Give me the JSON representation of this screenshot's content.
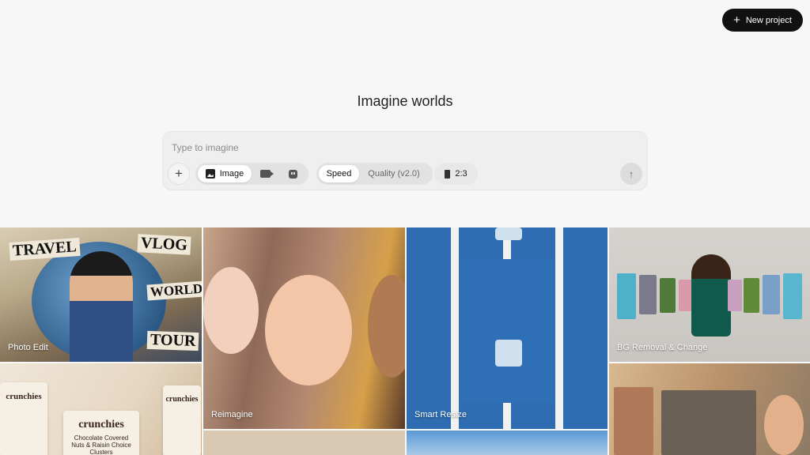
{
  "header": {
    "new_project_label": "New project"
  },
  "hero": {
    "title": "Imagine worlds"
  },
  "prompt": {
    "placeholder": "Type to imagine",
    "media_options": [
      {
        "label": "Image",
        "icon": "image-icon",
        "active": true
      },
      {
        "label": "",
        "icon": "video-icon",
        "active": false
      },
      {
        "label": "",
        "icon": "character-icon",
        "active": false
      }
    ],
    "mode_options": [
      {
        "label": "Speed",
        "active": true
      },
      {
        "label": "Quality (v2.0)",
        "active": false
      }
    ],
    "aspect_ratio": "2:3"
  },
  "gallery": {
    "tiles": [
      {
        "label": "Photo Edit"
      },
      {
        "label": "Reimagine"
      },
      {
        "label": "Smart Resize"
      },
      {
        "label": "BG Removal & Change"
      }
    ],
    "travel_words": [
      "TRAVEL",
      "VLOG",
      "WORLD",
      "TOUR"
    ],
    "pouch_brand": "crunchies",
    "pouch_subtitle": "Chocolate Covered Nuts & Raisin Choice Clusters"
  },
  "colors": {
    "accent": "#111111",
    "background": "#f7f7f7"
  }
}
